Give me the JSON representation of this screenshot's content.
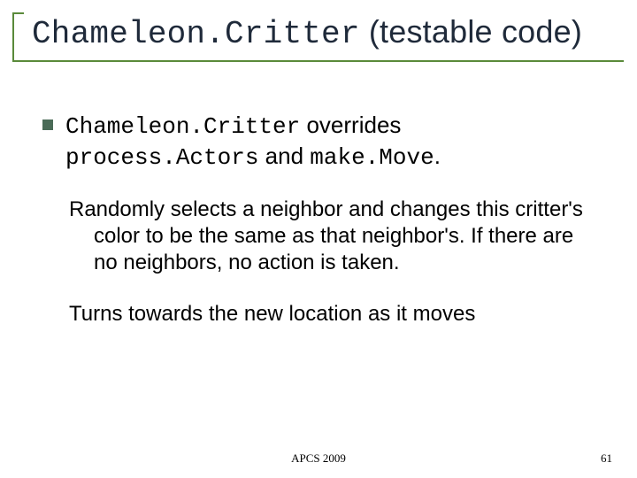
{
  "title": {
    "code": "Chameleon.Critter",
    "rest": " (testable code)"
  },
  "bullet1": {
    "code1": "Chameleon.Critter",
    "mid1": " overrides ",
    "code2": "process.Actors",
    "mid2": " and ",
    "code3": "make.Move",
    "end": "."
  },
  "para1": "Randomly selects a neighbor and changes this critter's color to be the same as that neighbor's. If there are no neighbors, no action is taken.",
  "para2": "Turns towards the new location as it moves",
  "footer": {
    "center": "APCS 2009",
    "page": "61"
  }
}
